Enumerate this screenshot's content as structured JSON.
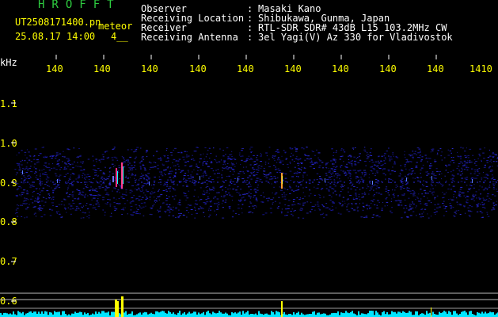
{
  "header": {
    "title": "HROFFT",
    "filename": "UT2508171400.pn",
    "meteor_label": "meteor",
    "datetime": "25.08.17 14:00",
    "index": "4__",
    "rows": [
      {
        "label": "Observer",
        "colon": ":",
        "value": "Masaki Kano"
      },
      {
        "label": "Receiving Location",
        "colon": ":",
        "value": "Shibukawa, Gunma, Japan"
      },
      {
        "label": "Receiver",
        "colon": ":",
        "value": "RTL-SDR SDR# 43dB L15 103.2MHz CW"
      },
      {
        "label": "Receiving Antenna",
        "colon": ":",
        "value": "3el Yagi(V) Az 330 for Vladivostok"
      }
    ]
  },
  "axes": {
    "x_unit": "kHz",
    "x_ticks": [
      "140",
      "140",
      "140",
      "140",
      "140",
      "140",
      "140",
      "140",
      "140",
      "1410"
    ],
    "y_ticks": [
      "1.1",
      "1.0",
      "0.9",
      "0.8",
      "0.7",
      "0.6"
    ]
  },
  "colors": {
    "text": "#ffffff",
    "accent": "#ffff00",
    "title": "#2ecc40",
    "noise": "#1a1aa0",
    "baseline": "#00e5ff"
  }
}
